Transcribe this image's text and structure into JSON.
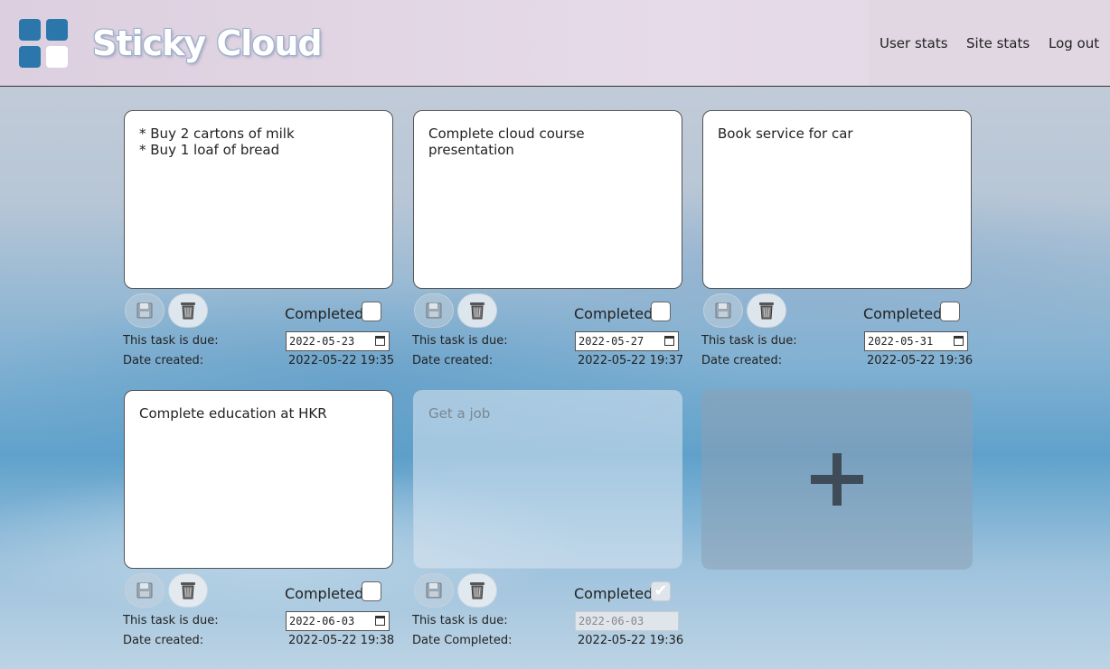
{
  "app": {
    "title": "Sticky Cloud"
  },
  "nav": [
    {
      "label": "User stats"
    },
    {
      "label": "Site stats"
    },
    {
      "label": "Log out"
    }
  ],
  "labels": {
    "completed": "Completed",
    "due": "This task is due:",
    "created": "Date created:",
    "completed_date": "Date Completed:"
  },
  "notes": [
    {
      "text": "* Buy 2 cartons of milk\n* Buy 1 loaf of bread",
      "due": "2022-05-23",
      "created": "2022-05-22 19:35",
      "completed": false
    },
    {
      "text": "Complete cloud course presentation",
      "due": "2022-05-27",
      "created": "2022-05-22 19:37",
      "completed": false
    },
    {
      "text": "Book service for car",
      "due": "2022-05-31",
      "created": "2022-05-22 19:36",
      "completed": false
    },
    {
      "text": "Complete education at HKR",
      "due": "2022-06-03",
      "created": "2022-05-22 19:38",
      "completed": false
    },
    {
      "text": "Get a job",
      "due": "2022-06-03",
      "created": "2022-05-22 19:36",
      "completed": true
    }
  ],
  "add_button": {
    "icon": "plus-icon"
  }
}
